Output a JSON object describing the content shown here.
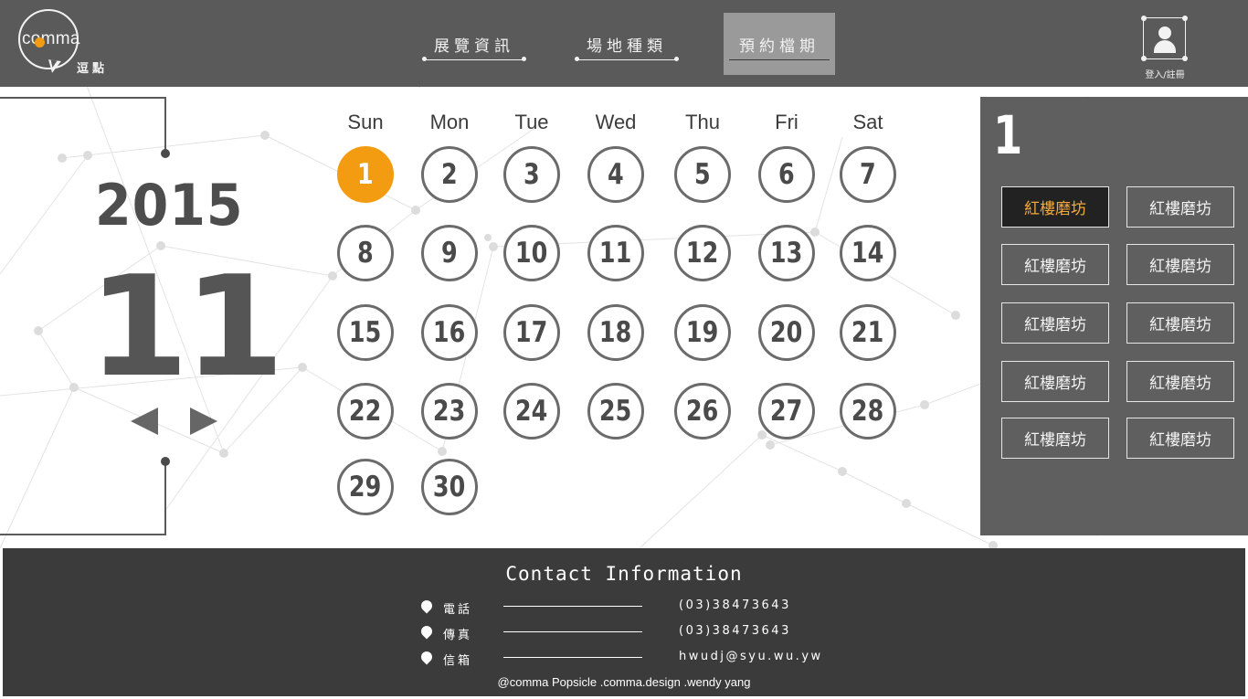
{
  "brand": {
    "word": "comma",
    "sub": "逗點",
    "accent": "#f39c12"
  },
  "nav": [
    {
      "label": "展覽資訊"
    },
    {
      "label": "場地種類"
    },
    {
      "label": "預約檔期"
    }
  ],
  "nav_active_index": 2,
  "login": {
    "label": "登入/註冊"
  },
  "date": {
    "year": "2015",
    "month": "11"
  },
  "calendar": {
    "weekdays": [
      "Sun",
      "Mon",
      "Tue",
      "Wed",
      "Thu",
      "Fri",
      "Sat"
    ],
    "days": [
      "1",
      "2",
      "3",
      "4",
      "5",
      "6",
      "7",
      "8",
      "9",
      "10",
      "11",
      "12",
      "13",
      "14",
      "15",
      "16",
      "17",
      "18",
      "19",
      "20",
      "21",
      "22",
      "23",
      "24",
      "25",
      "26",
      "27",
      "28",
      "29",
      "30"
    ],
    "selected_day": "1"
  },
  "venue_panel": {
    "day": "1",
    "venues": [
      "紅樓磨坊",
      "紅樓磨坊",
      "紅樓磨坊",
      "紅樓磨坊",
      "紅樓磨坊",
      "紅樓磨坊",
      "紅樓磨坊",
      "紅樓磨坊",
      "紅樓磨坊",
      "紅樓磨坊"
    ],
    "selected_index": 0
  },
  "footer": {
    "title": "Contact Information",
    "rows": [
      {
        "label": "電話",
        "value": "(03)38473643"
      },
      {
        "label": "傳真",
        "value": "(03)38473643"
      },
      {
        "label": "信箱",
        "value": "hwudj@syu.wu.yw"
      }
    ],
    "credits": "@comma Popsicle .comma.design .wendy yang"
  },
  "colors": {
    "header": "#5a5a5a",
    "footer": "#3b3b3b",
    "panel": "#5f5f5f",
    "accent": "#f39c12"
  }
}
